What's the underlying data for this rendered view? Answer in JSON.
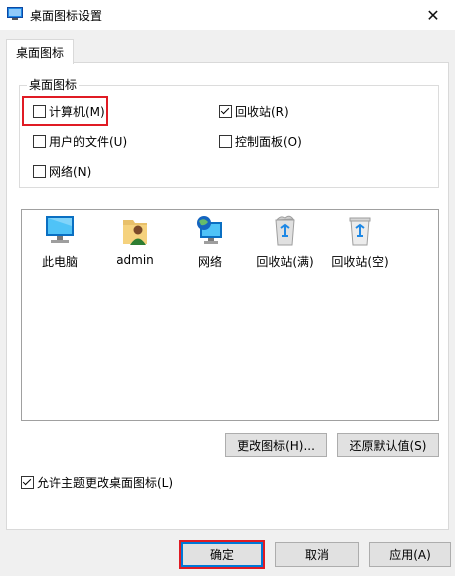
{
  "window": {
    "title": "桌面图标设置",
    "close_glyph": "✕"
  },
  "tab": {
    "label": "桌面图标"
  },
  "group": {
    "legend": "桌面图标",
    "checkboxes": [
      {
        "label": "计算机(M)",
        "checked": false
      },
      {
        "label": "回收站(R)",
        "checked": true
      },
      {
        "label": "用户的文件(U)",
        "checked": false
      },
      {
        "label": "控制面板(O)",
        "checked": false
      },
      {
        "label": "网络(N)",
        "checked": false
      }
    ]
  },
  "icons": [
    {
      "label": "此电脑",
      "icon": "computer-icon"
    },
    {
      "label": "admin",
      "icon": "user-folder-icon"
    },
    {
      "label": "网络",
      "icon": "network-icon"
    },
    {
      "label": "回收站(满)",
      "icon": "recycle-bin-full-icon"
    },
    {
      "label": "回收站(空)",
      "icon": "recycle-bin-empty-icon"
    }
  ],
  "buttons": {
    "change_icon": "更改图标(H)...",
    "restore_default": "还原默认值(S)",
    "ok": "确定",
    "cancel": "取消",
    "apply": "应用(A)"
  },
  "theme_checkbox": {
    "label": "允许主题更改桌面图标(L)",
    "checked": true
  },
  "colors": {
    "accent": "#0078d7",
    "highlight": "#e01b24"
  }
}
